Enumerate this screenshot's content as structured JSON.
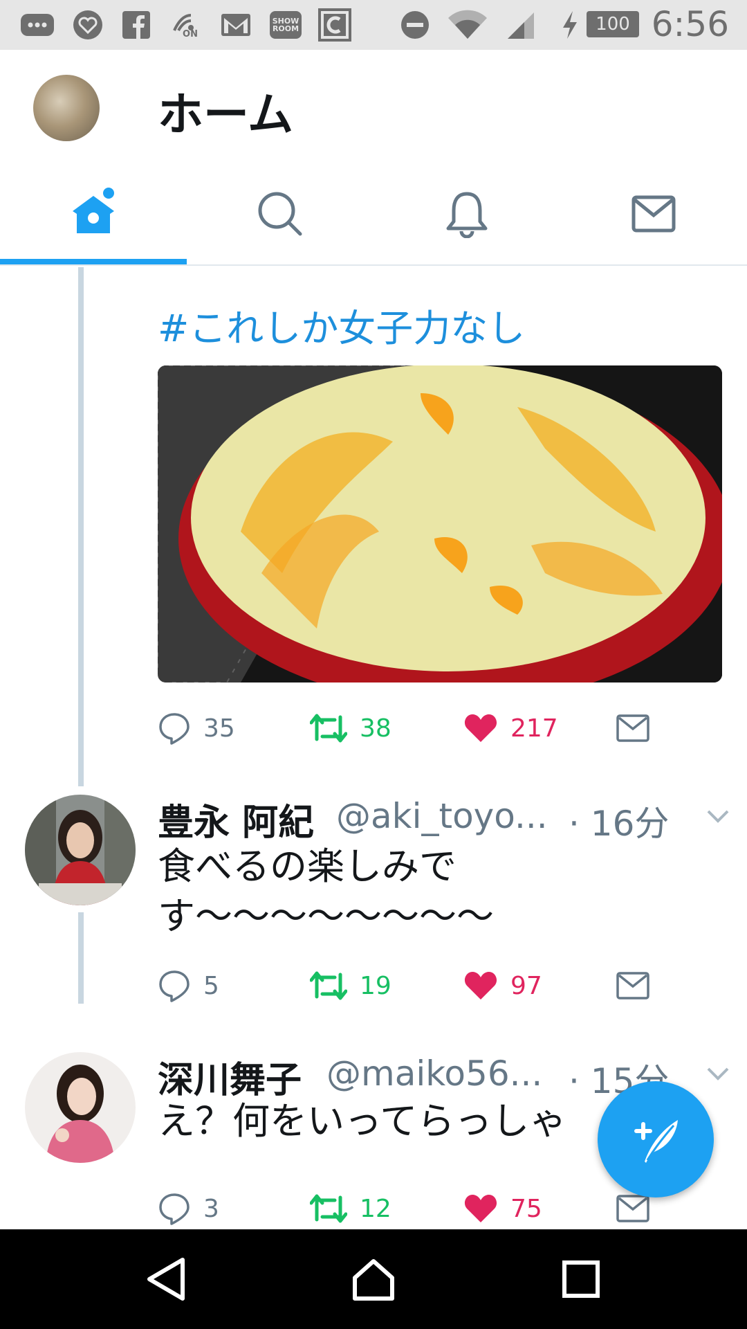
{
  "status_bar": {
    "battery": "100",
    "time": "6:56",
    "icons": [
      "messenger-icon",
      "heart-app-icon",
      "facebook-icon",
      "nfc-on-icon",
      "gmail-icon",
      "showroom-icon",
      "c-app-icon",
      "dnd-icon",
      "wifi-icon",
      "signal-icon",
      "charging-icon",
      "battery-icon"
    ],
    "showroom_label": "SHOW ROOM",
    "nfc_label": "ON"
  },
  "header": {
    "title": "ホーム"
  },
  "tabs": [
    {
      "name": "home",
      "icon": "home-icon",
      "active": true
    },
    {
      "name": "search",
      "icon": "search-icon"
    },
    {
      "name": "notifications",
      "icon": "bell-icon"
    },
    {
      "name": "messages",
      "icon": "mail-icon"
    }
  ],
  "tweets": [
    {
      "text": "#これしか女子力なし",
      "image": "cheesecake-photo",
      "replies": "35",
      "retweets": "38",
      "likes": "217"
    },
    {
      "name": "豊永 阿紀",
      "handle": "@aki_toyo...",
      "time": "· 16分",
      "text_line1": "食べるの楽しみで",
      "text_line2": "す～～～～～～～～",
      "replies": "5",
      "retweets": "19",
      "likes": "97"
    },
    {
      "name": "深川舞子",
      "handle": "@maiko56...",
      "time": "· 15分",
      "text": "え？何をいってらっしゃ",
      "replies": "3",
      "retweets": "12",
      "likes": "75"
    }
  ],
  "colors": {
    "accent": "#1da1f2",
    "retweet": "#17bf63",
    "like": "#e0245e",
    "muted": "#657786"
  },
  "fab": {
    "icon": "compose-tweet-icon"
  },
  "navbar": {
    "icons": [
      "back-icon",
      "home-nav-icon",
      "recents-icon"
    ]
  }
}
